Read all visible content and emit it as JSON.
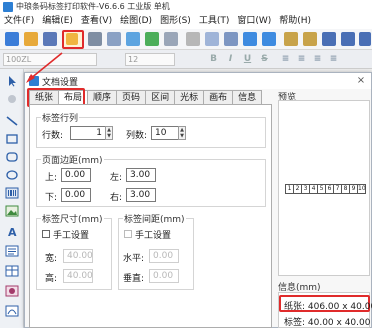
{
  "window": {
    "title": "中琅条码标签打印软件-V6.6.6 工业版 单机"
  },
  "menu": [
    "文件(F)",
    "编辑(E)",
    "查看(V)",
    "绘图(D)",
    "图形(S)",
    "工具(T)",
    "窗口(W)",
    "帮助(H)"
  ],
  "formatbar": {
    "font_combo": "100ZL",
    "size_combo": "12",
    "bold": "B",
    "italic": "I",
    "underline": "U",
    "strike": "S"
  },
  "dialog": {
    "title": "文档设置",
    "close": "×",
    "tabs": [
      "纸张",
      "布局",
      "顺序",
      "页码",
      "区间",
      "光标",
      "画布",
      "信息"
    ],
    "label_rows": {
      "group": "标签行列",
      "rows_label": "行数:",
      "rows_value": "1",
      "cols_label": "列数:",
      "cols_value": "10"
    },
    "margins": {
      "group": "页面边距(mm)",
      "top_label": "上:",
      "top_value": "0.00",
      "left_label": "左:",
      "left_value": "3.00",
      "bottom_label": "下:",
      "bottom_value": "0.00",
      "right_label": "右:",
      "right_value": "3.00"
    },
    "label_size": {
      "group": "标签尺寸(mm)",
      "manual": "手工设置",
      "width_label": "宽:",
      "width_value": "40.00",
      "height_label": "高:",
      "height_value": "40.00"
    },
    "label_spacing": {
      "group": "标签间距(mm)",
      "manual": "手工设置",
      "h_label": "水平:",
      "h_value": "0.00",
      "v_label": "垂直:",
      "v_value": "0.00"
    },
    "preview": {
      "label": "预览",
      "cells": [
        "1",
        "2",
        "3",
        "4",
        "5",
        "6",
        "7",
        "8",
        "9",
        "10"
      ]
    },
    "info": {
      "label": "信息(mm)",
      "paper": "纸张: 406.00 x 40.00",
      "label_size": "标签: 40.00 x 40.00"
    }
  },
  "colors": {
    "highlight": "#e02b2b",
    "accent": "#2d7fd3"
  }
}
